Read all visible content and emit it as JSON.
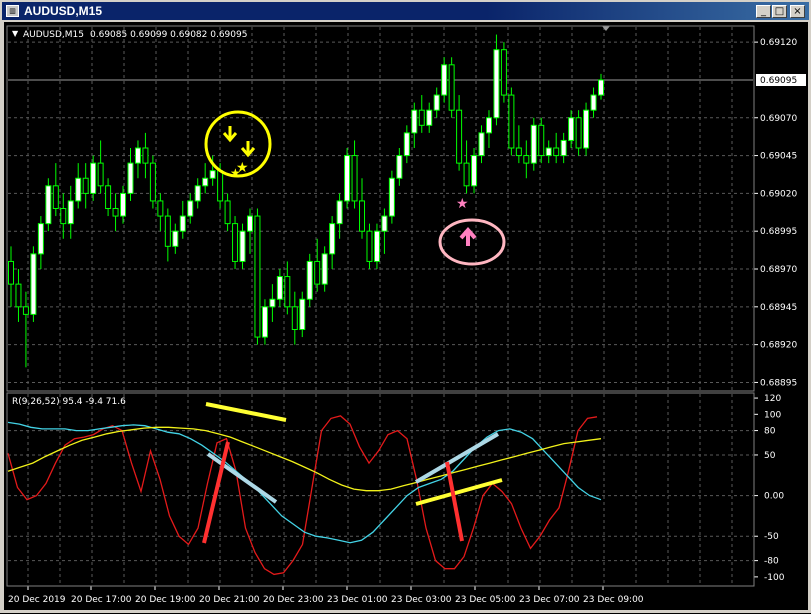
{
  "window": {
    "title": "AUDUSD,M15",
    "icon": "chart-window-icon",
    "buttons": {
      "minimize": "_",
      "maximize": "□",
      "close": "×"
    }
  },
  "colors": {
    "background": "#000000",
    "grid": "#5a5a5a",
    "axis_text": "#ffffff",
    "bull_candle": "#ffffff",
    "bear_candle": "#000000",
    "candle_outline": "#00ff00",
    "red_line": "#e41a1a",
    "cyan_line": "#43d3e6",
    "yellow_line": "#f2f21a",
    "sell_signal": "#ffff00",
    "buy_signal": "#ff80c0",
    "overlay_red": "#ff3030",
    "overlay_lightblue": "#add8e6",
    "overlay_yellow": "#ffff33",
    "current_price_line": "#9a9a9a"
  },
  "chart_data": [
    {
      "type": "candlestick",
      "title": "AUDUSD,M15  0.69085 0.69099 0.69082 0.69095",
      "symbol_label": "AUDUSD,M15",
      "ohlc_label": "0.69085 0.69099 0.69082 0.69095",
      "current_price": "0.69095",
      "y_ticks": [
        "0.69120",
        "0.69070",
        "0.69045",
        "0.69020",
        "0.68995",
        "0.68970",
        "0.68945",
        "0.68920",
        "0.68895"
      ],
      "ylim": [
        0.6889,
        0.6913
      ],
      "x_ticks": [
        "20 Dec 2019",
        "20 Dec 17:00",
        "20 Dec 19:00",
        "20 Dec 21:00",
        "20 Dec 23:00",
        "23 Dec 01:00",
        "23 Dec 03:00",
        "23 Dec 05:00",
        "23 Dec 07:00",
        "23 Dec 09:00"
      ],
      "candles": [
        [
          0.68975,
          0.68985,
          0.68945,
          0.6896
        ],
        [
          0.6896,
          0.6897,
          0.68935,
          0.68945
        ],
        [
          0.68945,
          0.68955,
          0.68905,
          0.6894
        ],
        [
          0.6894,
          0.68985,
          0.68935,
          0.6898
        ],
        [
          0.6898,
          0.69005,
          0.6897,
          0.69
        ],
        [
          0.69,
          0.6903,
          0.68995,
          0.69025
        ],
        [
          0.69025,
          0.6904,
          0.69005,
          0.6901
        ],
        [
          0.6901,
          0.6902,
          0.6899,
          0.69
        ],
        [
          0.69,
          0.69025,
          0.6899,
          0.69015
        ],
        [
          0.69015,
          0.6904,
          0.6901,
          0.6903
        ],
        [
          0.6903,
          0.6904,
          0.6901,
          0.6902
        ],
        [
          0.6902,
          0.69045,
          0.69015,
          0.6904
        ],
        [
          0.6904,
          0.69055,
          0.6902,
          0.69025
        ],
        [
          0.69025,
          0.6903,
          0.69005,
          0.6901
        ],
        [
          0.6901,
          0.6902,
          0.68995,
          0.69005
        ],
        [
          0.69005,
          0.69025,
          0.69,
          0.6902
        ],
        [
          0.6902,
          0.6905,
          0.69015,
          0.6904
        ],
        [
          0.6904,
          0.69055,
          0.6903,
          0.6905
        ],
        [
          0.6905,
          0.6906,
          0.6903,
          0.6904
        ],
        [
          0.6904,
          0.69045,
          0.6901,
          0.69015
        ],
        [
          0.69015,
          0.6902,
          0.68995,
          0.69005
        ],
        [
          0.69005,
          0.6901,
          0.68975,
          0.68985
        ],
        [
          0.68985,
          0.69,
          0.6898,
          0.68995
        ],
        [
          0.68995,
          0.69015,
          0.6899,
          0.69005
        ],
        [
          0.69005,
          0.6902,
          0.69,
          0.69015
        ],
        [
          0.69015,
          0.6903,
          0.6901,
          0.69025
        ],
        [
          0.69025,
          0.6904,
          0.6902,
          0.6903
        ],
        [
          0.6903,
          0.69045,
          0.69025,
          0.69035
        ],
        [
          0.69035,
          0.6904,
          0.6901,
          0.69015
        ],
        [
          0.69015,
          0.6902,
          0.68995,
          0.69
        ],
        [
          0.69,
          0.69005,
          0.6897,
          0.68975
        ],
        [
          0.68975,
          0.69,
          0.6897,
          0.68995
        ],
        [
          0.68995,
          0.6901,
          0.6898,
          0.69005
        ],
        [
          0.69005,
          0.6901,
          0.6892,
          0.68925
        ],
        [
          0.68925,
          0.6895,
          0.6892,
          0.68945
        ],
        [
          0.68945,
          0.6896,
          0.68935,
          0.6895
        ],
        [
          0.6895,
          0.6897,
          0.68945,
          0.68965
        ],
        [
          0.68965,
          0.68975,
          0.6894,
          0.68945
        ],
        [
          0.68945,
          0.68955,
          0.6892,
          0.6893
        ],
        [
          0.6893,
          0.68955,
          0.68925,
          0.6895
        ],
        [
          0.6895,
          0.6898,
          0.68945,
          0.68975
        ],
        [
          0.68975,
          0.6899,
          0.68955,
          0.6896
        ],
        [
          0.6896,
          0.68985,
          0.68955,
          0.6898
        ],
        [
          0.6898,
          0.69005,
          0.6897,
          0.69
        ],
        [
          0.69,
          0.6902,
          0.6899,
          0.69015
        ],
        [
          0.69015,
          0.6905,
          0.6901,
          0.69045
        ],
        [
          0.69045,
          0.69055,
          0.6901,
          0.69015
        ],
        [
          0.69015,
          0.6903,
          0.6899,
          0.68995
        ],
        [
          0.68995,
          0.69,
          0.6897,
          0.68975
        ],
        [
          0.68975,
          0.69,
          0.6897,
          0.68995
        ],
        [
          0.68995,
          0.6901,
          0.6898,
          0.69005
        ],
        [
          0.69005,
          0.69035,
          0.69,
          0.6903
        ],
        [
          0.6903,
          0.6905,
          0.69025,
          0.69045
        ],
        [
          0.69045,
          0.69065,
          0.6904,
          0.6906
        ],
        [
          0.6906,
          0.6908,
          0.6905,
          0.69075
        ],
        [
          0.69075,
          0.69085,
          0.6906,
          0.69065
        ],
        [
          0.69065,
          0.6908,
          0.6906,
          0.69075
        ],
        [
          0.69075,
          0.6909,
          0.6907,
          0.69085
        ],
        [
          0.69085,
          0.6911,
          0.6908,
          0.69105
        ],
        [
          0.69105,
          0.6911,
          0.6907,
          0.69075
        ],
        [
          0.69075,
          0.69085,
          0.69035,
          0.6904
        ],
        [
          0.6904,
          0.69055,
          0.6902,
          0.69025
        ],
        [
          0.69025,
          0.6905,
          0.6902,
          0.69045
        ],
        [
          0.69045,
          0.69065,
          0.6904,
          0.6906
        ],
        [
          0.6906,
          0.69075,
          0.6905,
          0.6907
        ],
        [
          0.6907,
          0.69125,
          0.69065,
          0.69115
        ],
        [
          0.69115,
          0.6912,
          0.6908,
          0.69085
        ],
        [
          0.69085,
          0.6909,
          0.69045,
          0.6905
        ],
        [
          0.6905,
          0.69065,
          0.6904,
          0.69045
        ],
        [
          0.69045,
          0.69055,
          0.6903,
          0.6904
        ],
        [
          0.6904,
          0.6907,
          0.69035,
          0.69065
        ],
        [
          0.69065,
          0.6907,
          0.6904,
          0.69045
        ],
        [
          0.69045,
          0.69055,
          0.6904,
          0.6905
        ],
        [
          0.6905,
          0.6906,
          0.6904,
          0.69045
        ],
        [
          0.69045,
          0.6906,
          0.6904,
          0.69055
        ],
        [
          0.69055,
          0.69075,
          0.6905,
          0.6907
        ],
        [
          0.6907,
          0.69075,
          0.69045,
          0.6905
        ],
        [
          0.6905,
          0.6908,
          0.69045,
          0.69075
        ],
        [
          0.69075,
          0.6909,
          0.6907,
          0.69085
        ],
        [
          0.69085,
          0.69099,
          0.69082,
          0.69095
        ]
      ]
    },
    {
      "type": "line",
      "title": "R(9,26,52) 95.4 -9.4 71.6",
      "y_ticks": [
        "120",
        "100",
        "80",
        "50",
        "0.00",
        "-50",
        "-80",
        "-100"
      ],
      "ylim": [
        -110,
        125
      ],
      "series": [
        {
          "name": "",
          "color": "red",
          "values": [
            52,
            10,
            -5,
            0,
            15,
            40,
            62,
            70,
            72,
            75,
            82,
            86,
            80,
            40,
            5,
            55,
            20,
            -25,
            -50,
            -60,
            -40,
            15,
            65,
            70,
            30,
            -40,
            -70,
            -90,
            -97,
            -95,
            -80,
            -60,
            10,
            80,
            95,
            98,
            88,
            60,
            40,
            55,
            75,
            80,
            70,
            20,
            -40,
            -80,
            -90,
            -90,
            -75,
            -40,
            0,
            15,
            5,
            -10,
            -40,
            -65,
            -50,
            -30,
            -15,
            30,
            80,
            95,
            97
          ]
        },
        {
          "name": "",
          "color": "cyan",
          "values": [
            90,
            88,
            84,
            82,
            82,
            82,
            80,
            80,
            82,
            84,
            86,
            87,
            86,
            82,
            78,
            76,
            70,
            62,
            52,
            42,
            30,
            18,
            5,
            -10,
            -25,
            -35,
            -45,
            -50,
            -52,
            -55,
            -58,
            -55,
            -45,
            -30,
            -15,
            0,
            10,
            15,
            20,
            30,
            45,
            60,
            72,
            80,
            82,
            78,
            70,
            55,
            40,
            25,
            10,
            0,
            -5
          ]
        },
        {
          "name": "",
          "color": "yellow",
          "values": [
            30,
            35,
            40,
            48,
            55,
            62,
            68,
            72,
            76,
            79,
            81,
            83,
            84,
            84,
            83,
            82,
            80,
            76,
            72,
            66,
            60,
            54,
            48,
            42,
            35,
            28,
            20,
            13,
            8,
            6,
            6,
            8,
            12,
            16,
            20,
            24,
            28,
            32,
            36,
            40,
            44,
            48,
            52,
            56,
            60,
            64,
            66,
            68,
            70
          ]
        }
      ]
    }
  ],
  "annotations": {
    "sell_arrow": "down-arrow",
    "buy_arrow": "up-arrow",
    "star": "★"
  }
}
